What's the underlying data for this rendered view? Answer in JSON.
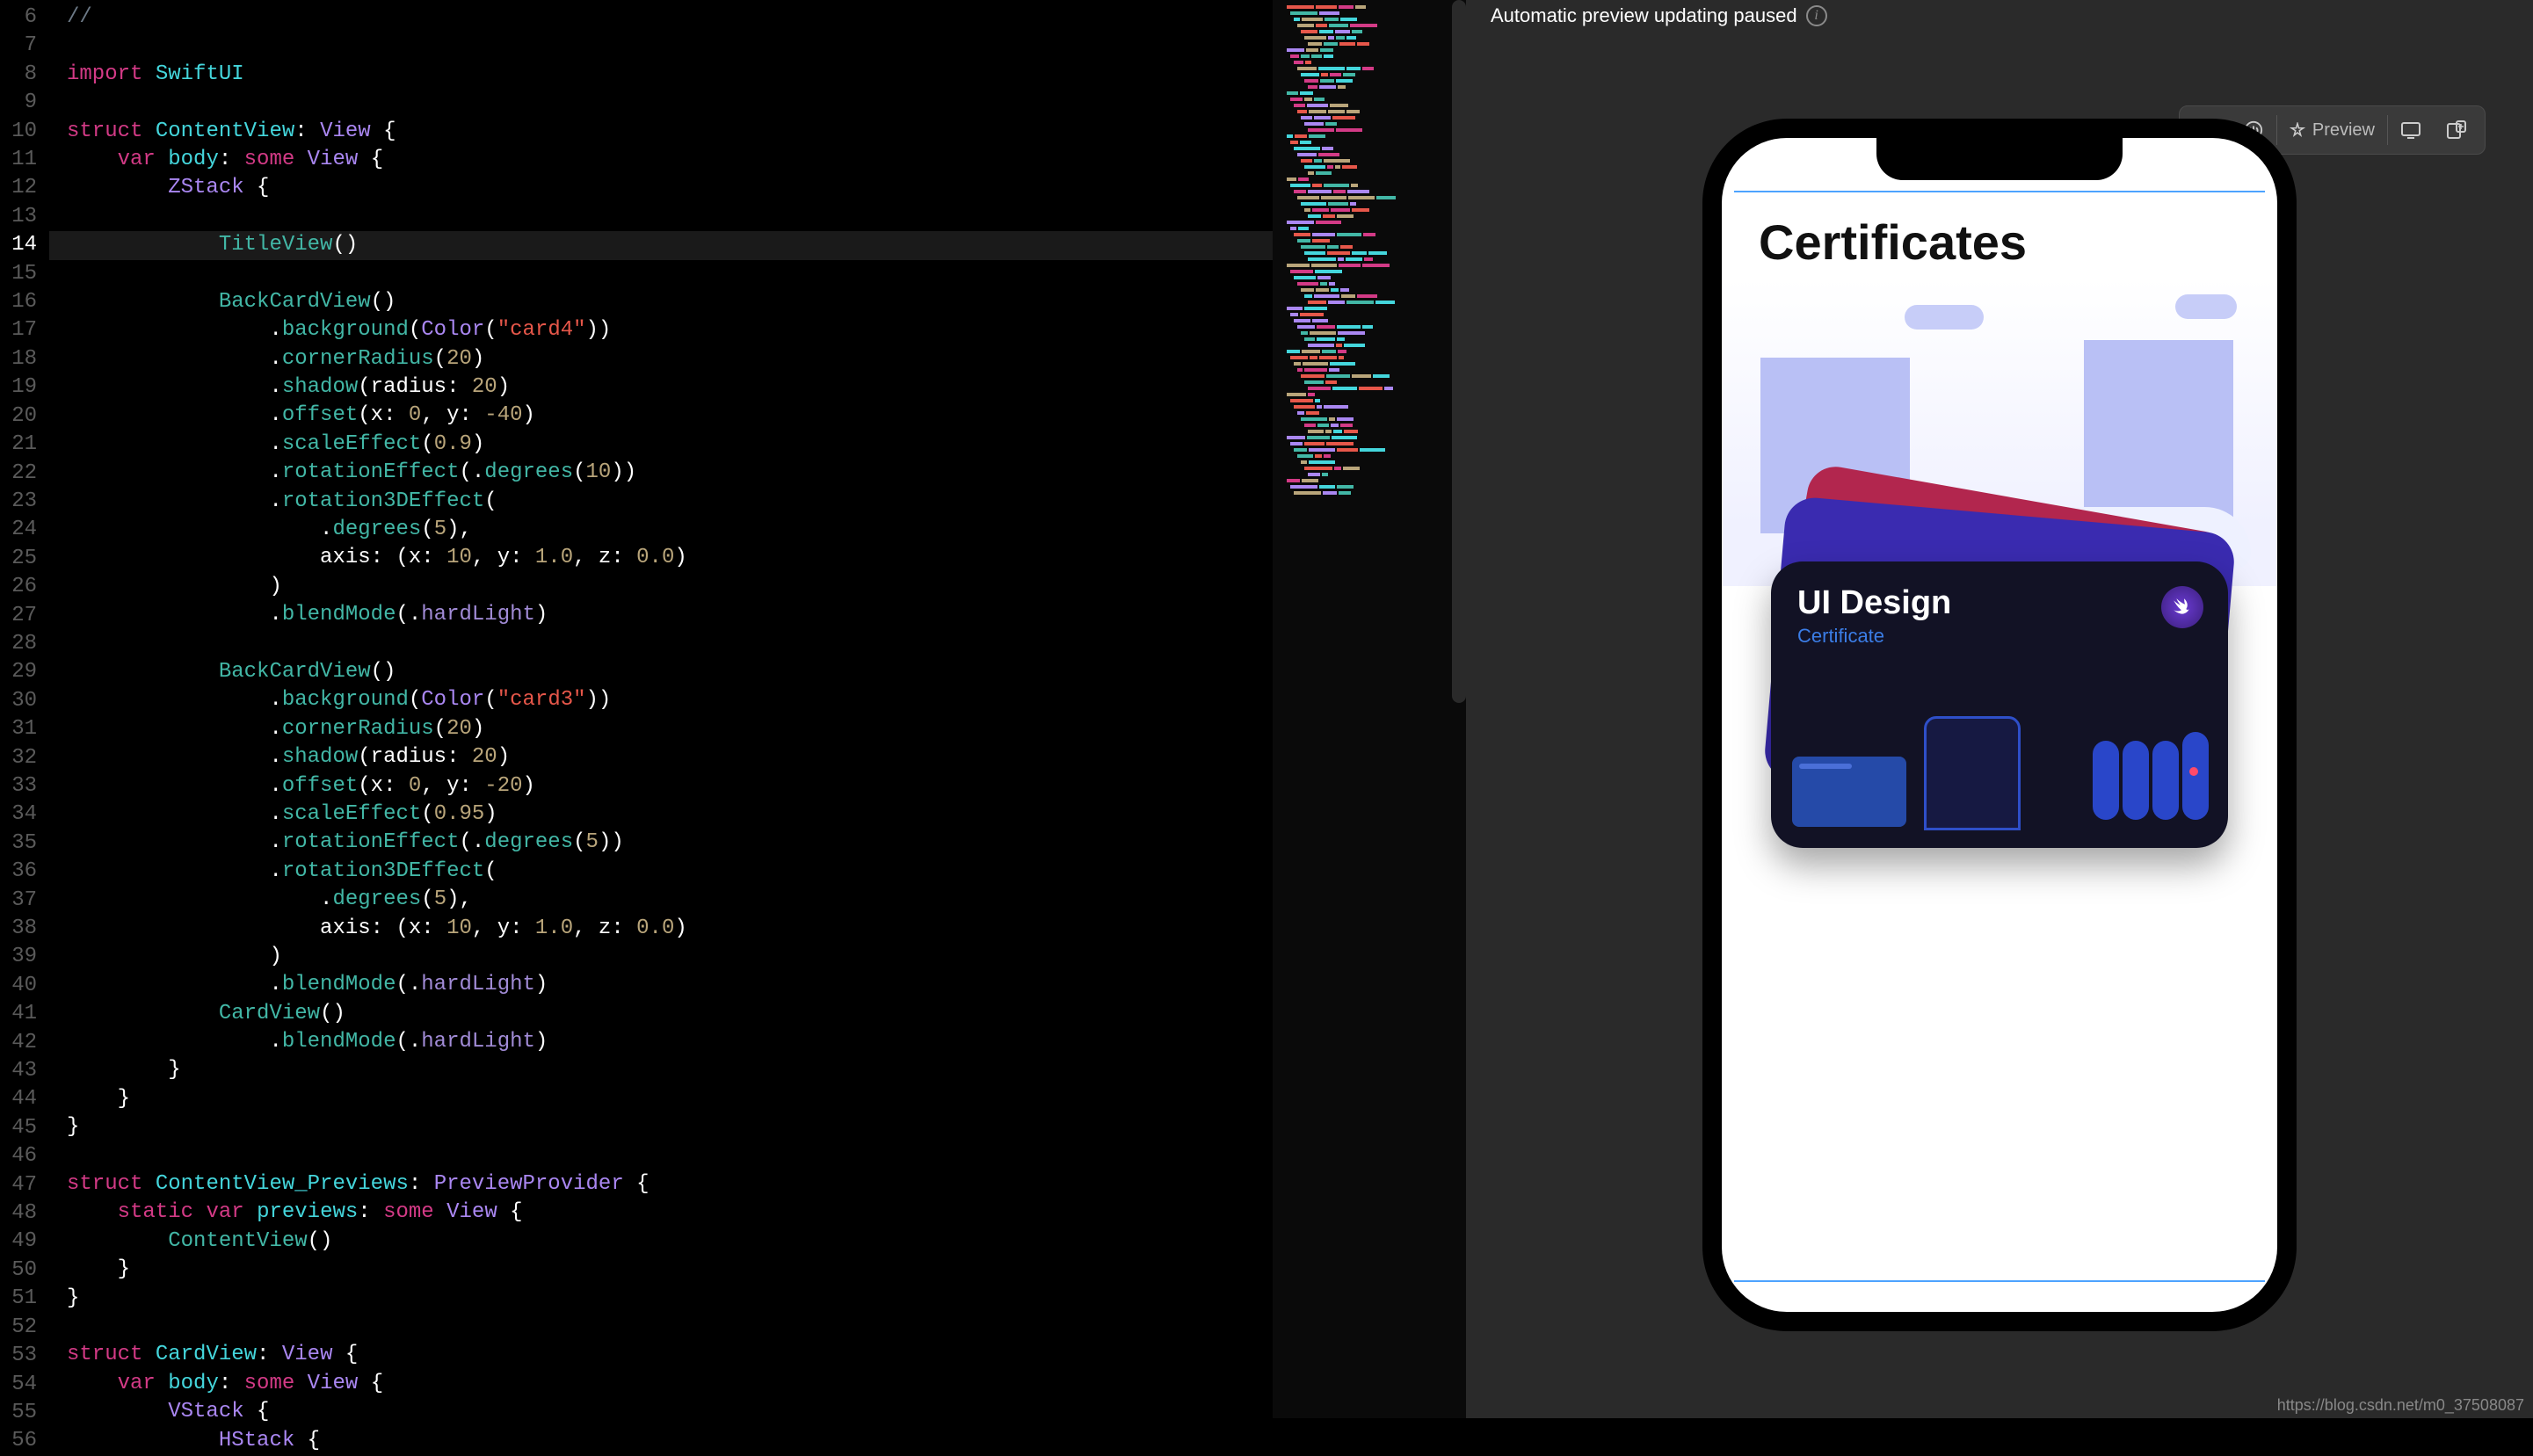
{
  "editor": {
    "lines": [
      {
        "n": 6,
        "cls": "cm",
        "code": "//"
      },
      {
        "n": 7,
        "cls": "",
        "code": ""
      },
      {
        "n": 8,
        "cls": "",
        "code": "<kw>import</kw> <id>SwiftUI</id>"
      },
      {
        "n": 9,
        "cls": "",
        "code": ""
      },
      {
        "n": 10,
        "cls": "",
        "code": "<kw>struct</kw> <id>ContentView</id><pn>:</pn> <ty>View</ty> <pn>{</pn>"
      },
      {
        "n": 11,
        "cls": "",
        "code": "    <kw>var</kw> <id>body</id><pn>:</pn> <kw>some</kw> <ty>View</ty> <pn>{</pn>"
      },
      {
        "n": 12,
        "cls": "",
        "code": "        <ty>ZStack</ty> <pn>{</pn>"
      },
      {
        "n": 13,
        "cls": "",
        "code": ""
      },
      {
        "n": 14,
        "cls": "current",
        "code": "            <fn>TitleView</fn><pn>()</pn>"
      },
      {
        "n": 15,
        "cls": "",
        "code": ""
      },
      {
        "n": 16,
        "cls": "",
        "code": "            <fn>BackCardView</fn><pn>()</pn>"
      },
      {
        "n": 17,
        "cls": "",
        "code": "                <pn>.</pn><fn>background</fn><pn>(</pn><ty>Color</ty><pn>(</pn><st>\"card4\"</st><pn>))</pn>"
      },
      {
        "n": 18,
        "cls": "",
        "code": "                <pn>.</pn><fn>cornerRadius</fn><pn>(</pn><nm>20</nm><pn>)</pn>"
      },
      {
        "n": 19,
        "cls": "",
        "code": "                <pn>.</pn><fn>shadow</fn><pn>(radius: </pn><nm>20</nm><pn>)</pn>"
      },
      {
        "n": 20,
        "cls": "",
        "code": "                <pn>.</pn><fn>offset</fn><pn>(x: </pn><nm>0</nm><pn>, y: </pn><nm>-40</nm><pn>)</pn>"
      },
      {
        "n": 21,
        "cls": "",
        "code": "                <pn>.</pn><fn>scaleEffect</fn><pn>(</pn><nm>0.9</nm><pn>)</pn>"
      },
      {
        "n": 22,
        "cls": "",
        "code": "                <pn>.</pn><fn>rotationEffect</fn><pn>(.</pn><fn>degrees</fn><pn>(</pn><nm>10</nm><pn>))</pn>"
      },
      {
        "n": 23,
        "cls": "",
        "code": "                <pn>.</pn><fn>rotation3DEffect</fn><pn>(</pn>"
      },
      {
        "n": 24,
        "cls": "",
        "code": "                    <pn>.</pn><fn>degrees</fn><pn>(</pn><nm>5</nm><pn>),</pn>"
      },
      {
        "n": 25,
        "cls": "",
        "code": "                    <pn>axis: (x: </pn><nm>10</nm><pn>, y: </pn><nm>1.0</nm><pn>, z: </pn><nm>0.0</nm><pn>)</pn>"
      },
      {
        "n": 26,
        "cls": "",
        "code": "                <pn>)</pn>"
      },
      {
        "n": 27,
        "cls": "",
        "code": "                <pn>.</pn><fn>blendMode</fn><pn>(.</pn><en>hardLight</en><pn>)</pn>"
      },
      {
        "n": 28,
        "cls": "",
        "code": ""
      },
      {
        "n": 29,
        "cls": "",
        "code": "            <fn>BackCardView</fn><pn>()</pn>"
      },
      {
        "n": 30,
        "cls": "",
        "code": "                <pn>.</pn><fn>background</fn><pn>(</pn><ty>Color</ty><pn>(</pn><st>\"card3\"</st><pn>))</pn>"
      },
      {
        "n": 31,
        "cls": "",
        "code": "                <pn>.</pn><fn>cornerRadius</fn><pn>(</pn><nm>20</nm><pn>)</pn>"
      },
      {
        "n": 32,
        "cls": "",
        "code": "                <pn>.</pn><fn>shadow</fn><pn>(radius: </pn><nm>20</nm><pn>)</pn>"
      },
      {
        "n": 33,
        "cls": "",
        "code": "                <pn>.</pn><fn>offset</fn><pn>(x: </pn><nm>0</nm><pn>, y: </pn><nm>-20</nm><pn>)</pn>"
      },
      {
        "n": 34,
        "cls": "",
        "code": "                <pn>.</pn><fn>scaleEffect</fn><pn>(</pn><nm>0.95</nm><pn>)</pn>"
      },
      {
        "n": 35,
        "cls": "",
        "code": "                <pn>.</pn><fn>rotationEffect</fn><pn>(.</pn><fn>degrees</fn><pn>(</pn><nm>5</nm><pn>))</pn>"
      },
      {
        "n": 36,
        "cls": "",
        "code": "                <pn>.</pn><fn>rotation3DEffect</fn><pn>(</pn>"
      },
      {
        "n": 37,
        "cls": "",
        "code": "                    <pn>.</pn><fn>degrees</fn><pn>(</pn><nm>5</nm><pn>),</pn>"
      },
      {
        "n": 38,
        "cls": "",
        "code": "                    <pn>axis: (x: </pn><nm>10</nm><pn>, y: </pn><nm>1.0</nm><pn>, z: </pn><nm>0.0</nm><pn>)</pn>"
      },
      {
        "n": 39,
        "cls": "",
        "code": "                <pn>)</pn>"
      },
      {
        "n": 40,
        "cls": "",
        "code": "                <pn>.</pn><fn>blendMode</fn><pn>(.</pn><en>hardLight</en><pn>)</pn>"
      },
      {
        "n": 41,
        "cls": "",
        "code": "            <fn>CardView</fn><pn>()</pn>"
      },
      {
        "n": 42,
        "cls": "",
        "code": "                <pn>.</pn><fn>blendMode</fn><pn>(.</pn><en>hardLight</en><pn>)</pn>"
      },
      {
        "n": 43,
        "cls": "",
        "code": "        <pn>}</pn>"
      },
      {
        "n": 44,
        "cls": "",
        "code": "    <pn>}</pn>"
      },
      {
        "n": 45,
        "cls": "",
        "code": "<pn>}</pn>"
      },
      {
        "n": 46,
        "cls": "",
        "code": ""
      },
      {
        "n": 47,
        "cls": "",
        "code": "<kw>struct</kw> <id>ContentView_Previews</id><pn>:</pn> <ty>PreviewProvider</ty> <pn>{</pn>"
      },
      {
        "n": 48,
        "cls": "",
        "code": "    <kw>static</kw> <kw>var</kw> <id>previews</id><pn>:</pn> <kw>some</kw> <ty>View</ty> <pn>{</pn>"
      },
      {
        "n": 49,
        "cls": "",
        "code": "        <fn>ContentView</fn><pn>()</pn>"
      },
      {
        "n": 50,
        "cls": "",
        "code": "    <pn>}</pn>"
      },
      {
        "n": 51,
        "cls": "",
        "code": "<pn>}</pn>"
      },
      {
        "n": 52,
        "cls": "",
        "code": ""
      },
      {
        "n": 53,
        "cls": "",
        "code": "<kw>struct</kw> <id>CardView</id><pn>:</pn> <ty>View</ty> <pn>{</pn>"
      },
      {
        "n": 54,
        "cls": "",
        "code": "    <kw>var</kw> <id>body</id><pn>:</pn> <kw>some</kw> <ty>View</ty> <pn>{</pn>"
      },
      {
        "n": 55,
        "cls": "",
        "code": "        <ty>VStack</ty> <pn>{</pn>"
      },
      {
        "n": 56,
        "cls": "",
        "code": "            <ty>HStack</ty> <pn>{</pn>"
      }
    ]
  },
  "preview": {
    "statusText": "Automatic preview updating paused",
    "previewLabel": "Preview",
    "buttons": {
      "play": "play-icon",
      "power": "power-icon",
      "pin": "pin-icon",
      "device": "device-icon",
      "add": "add-device-icon"
    }
  },
  "app": {
    "title": "Certificates",
    "card": {
      "title": "UI Design",
      "subtitle": "Certificate"
    }
  },
  "watermark": "https://blog.csdn.net/m0_37508087"
}
